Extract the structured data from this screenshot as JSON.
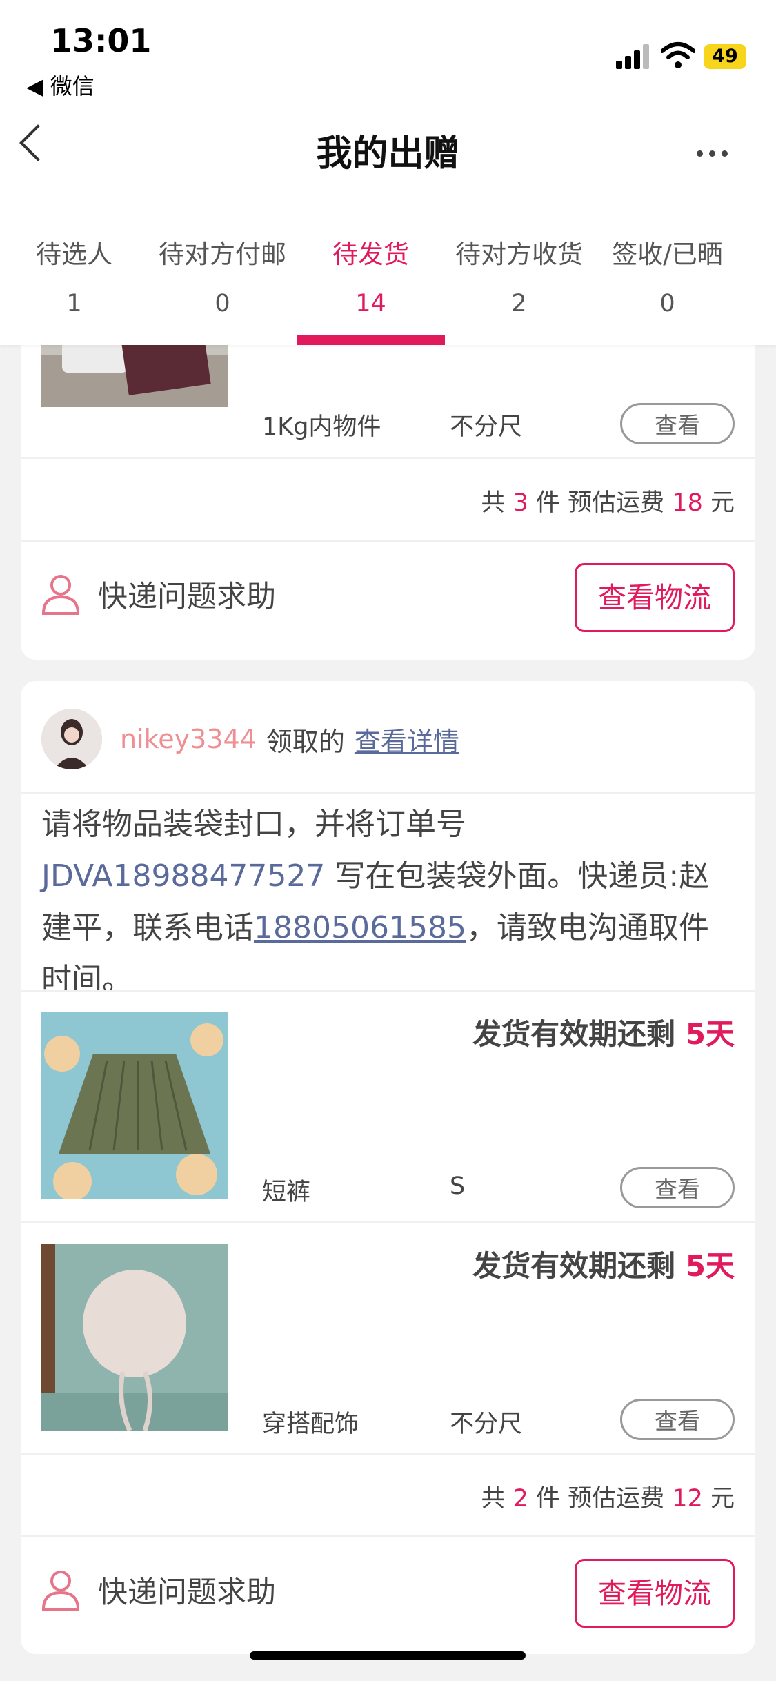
{
  "status_bar": {
    "time": "13:01",
    "back_app": "◀ 微信",
    "battery": "49"
  },
  "nav": {
    "title": "我的出赠"
  },
  "tabs": [
    {
      "label": "待选人",
      "count": "1"
    },
    {
      "label": "待对方付邮",
      "count": "0"
    },
    {
      "label": "待发货",
      "count": "14",
      "active": true
    },
    {
      "label": "待对方收货",
      "count": "2"
    },
    {
      "label": "签收/已晒",
      "count": "0"
    }
  ],
  "card1": {
    "item": {
      "category": "1Kg内物件",
      "size": "不分尺",
      "view_label": "查看"
    },
    "summary": {
      "prefix": "共",
      "count": "3",
      "mid": "件 预估运费",
      "fee": "18",
      "suffix": "元"
    },
    "help_label": "快递问题求助",
    "logistics_label": "查看物流"
  },
  "card2": {
    "username": "nikey3344",
    "claim_text": "领取的",
    "detail_link": "查看详情",
    "instruction": {
      "part1": "请将物品装袋封口，并将订单号",
      "order_code": "JDVA18988477527",
      "part2": "写在包装袋外面。快递员:赵建平，联系电话",
      "phone": "18805061585",
      "part3": "，请致电沟通取件时间。"
    },
    "items": [
      {
        "deadline_label": "发货有效期还剩",
        "days": "5天",
        "category": "短裤",
        "size": "S",
        "view_label": "查看"
      },
      {
        "deadline_label": "发货有效期还剩",
        "days": "5天",
        "category": "穿搭配饰",
        "size": "不分尺",
        "view_label": "查看"
      }
    ],
    "summary": {
      "prefix": "共",
      "count": "2",
      "mid": "件 预估运费",
      "fee": "12",
      "suffix": "元"
    },
    "help_label": "快递问题求助",
    "logistics_label": "查看物流"
  },
  "colors": {
    "accent": "#e01a5b",
    "link": "#5a6a9b",
    "username": "#ee8f94"
  },
  "icons": [
    "back-chevron-icon",
    "more-icon",
    "person-icon",
    "signal-icon",
    "wifi-icon"
  ]
}
